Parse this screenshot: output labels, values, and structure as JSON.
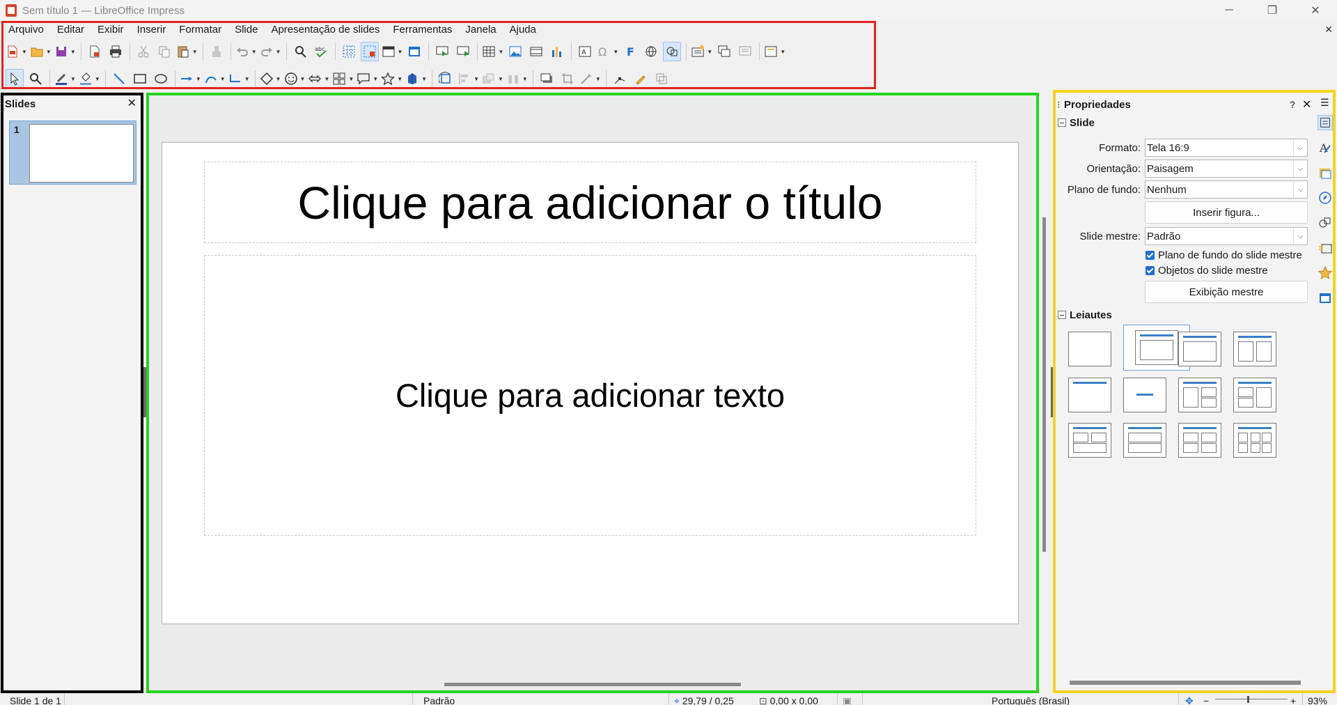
{
  "window": {
    "title": "Sem título 1 — LibreOffice Impress",
    "minimize_glyph": "─",
    "maximize_glyph": "❐",
    "close_glyph": "✕",
    "doc_close_glyph": "✕"
  },
  "menubar": {
    "items": [
      "Arquivo",
      "Editar",
      "Exibir",
      "Inserir",
      "Formatar",
      "Slide",
      "Apresentação de slides",
      "Ferramentas",
      "Janela",
      "Ajuda"
    ]
  },
  "toolbar_icons": {
    "standard": [
      "new-document-icon",
      "open-icon",
      "save-icon",
      "export-pdf-icon",
      "print-icon",
      "cut-icon",
      "copy-icon",
      "paste-icon",
      "clone-formatting-icon",
      "undo-icon",
      "redo-icon",
      "find-replace-icon",
      "spelling-icon",
      "display-grid-icon",
      "helplines-icon",
      "display-views-icon",
      "master-slide-icon",
      "start-first-slide-icon",
      "start-current-slide-icon",
      "insert-table-icon",
      "insert-image-icon",
      "insert-media-icon",
      "insert-chart-icon",
      "insert-textbox-icon",
      "special-character-icon",
      "fontwork-icon",
      "hyperlink-icon",
      "show-draw-functions-icon",
      "new-slide-icon",
      "duplicate-slide-icon",
      "delete-slide-icon",
      "slide-layout-icon"
    ],
    "drawing": [
      "select-icon",
      "zoom-pan-icon",
      "line-color-icon",
      "fill-color-icon",
      "line-icon",
      "rectangle-icon",
      "ellipse-icon",
      "arrow-line-icon",
      "curve-icon",
      "connector-icon",
      "basic-shapes-icon",
      "symbol-shapes-icon",
      "block-arrows-icon",
      "flowchart-icon",
      "callouts-icon",
      "stars-icon",
      "3d-objects-icon",
      "rotate-icon",
      "align-icon",
      "arrange-icon",
      "distribute-icon",
      "shadow-icon",
      "crop-icon",
      "filter-icon",
      "points-icon",
      "glue-points-icon",
      "toggle-extrusion-icon"
    ]
  },
  "slides_pane": {
    "title": "Slides",
    "close_glyph": "✕",
    "slides": [
      {
        "number": "1"
      }
    ]
  },
  "slide": {
    "title_placeholder": "Clique para adicionar o título",
    "body_placeholder": "Clique para adicionar texto"
  },
  "properties": {
    "title": "Propriedades",
    "help_glyph": "?",
    "close_glyph": "✕",
    "section_slide": "Slide",
    "format_label": "Formato:",
    "format_value": "Tela 16:9",
    "orientation_label": "Orientação:",
    "orientation_value": "Paisagem",
    "background_label": "Plano de fundo:",
    "background_value": "Nenhum",
    "insert_image_button": "Inserir figura...",
    "master_slide_label": "Slide mestre:",
    "master_slide_value": "Padrão",
    "master_background_checkbox": "Plano de fundo do slide mestre",
    "master_objects_checkbox": "Objetos do slide mestre",
    "master_view_button": "Exibição mestre",
    "section_layouts": "Leiautes",
    "dropdown_glyph": "⌵"
  },
  "sidebar_tabs": [
    "properties-icon",
    "styles-icon",
    "gallery-icon",
    "navigator-icon",
    "shapes-icon",
    "slide-transition-icon",
    "animation-icon",
    "master-slides-icon"
  ],
  "statusbar": {
    "slide_info": "Slide 1 de 1",
    "master_name": "Padrão",
    "position": "29,79 / 0,25",
    "size": "0,00 x 0,00",
    "language": "Português (Brasil)",
    "zoom_minus": "−",
    "zoom_plus": "+",
    "zoom_level": "93%"
  },
  "colors": {
    "accent": "#1e6fcf",
    "annotation_red": "#e52121",
    "annotation_black": "#000000",
    "annotation_green": "#22d51c",
    "annotation_yellow": "#f4d41c"
  }
}
